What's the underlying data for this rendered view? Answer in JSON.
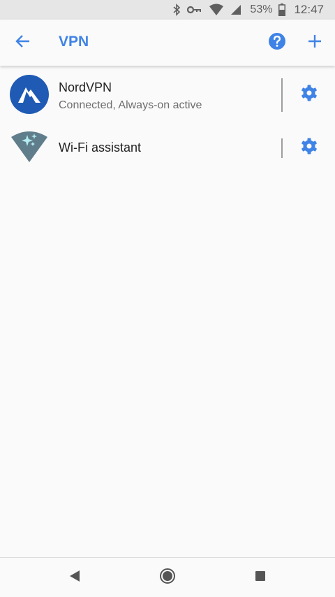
{
  "status_bar": {
    "battery_percent": "53%",
    "time": "12:47",
    "icons": [
      "bluetooth-icon",
      "vpn-key-icon",
      "wifi-icon",
      "cell-signal-icon",
      "battery-icon"
    ]
  },
  "app_bar": {
    "title": "VPN",
    "back_icon": "arrow-back-icon",
    "help_icon": "help-icon",
    "add_icon": "add-icon"
  },
  "vpn_list": [
    {
      "name": "NordVPN",
      "status": "Connected, Always-on active",
      "icon": "nordvpn-logo-icon",
      "settings_icon": "gear-icon"
    },
    {
      "name": "Wi-Fi assistant",
      "status": "",
      "icon": "wifi-assistant-icon",
      "settings_icon": "gear-icon"
    }
  ],
  "nav_bar": {
    "buttons": [
      "back-triangle-icon",
      "home-circle-icon",
      "recents-square-icon"
    ]
  },
  "colors": {
    "accent": "#3f83e6",
    "background": "#fafafa",
    "status_bar": "#e6e6e6",
    "nordvpn_blue": "#1f5bb4",
    "wifi_assistant_gray": "#607d8b"
  }
}
